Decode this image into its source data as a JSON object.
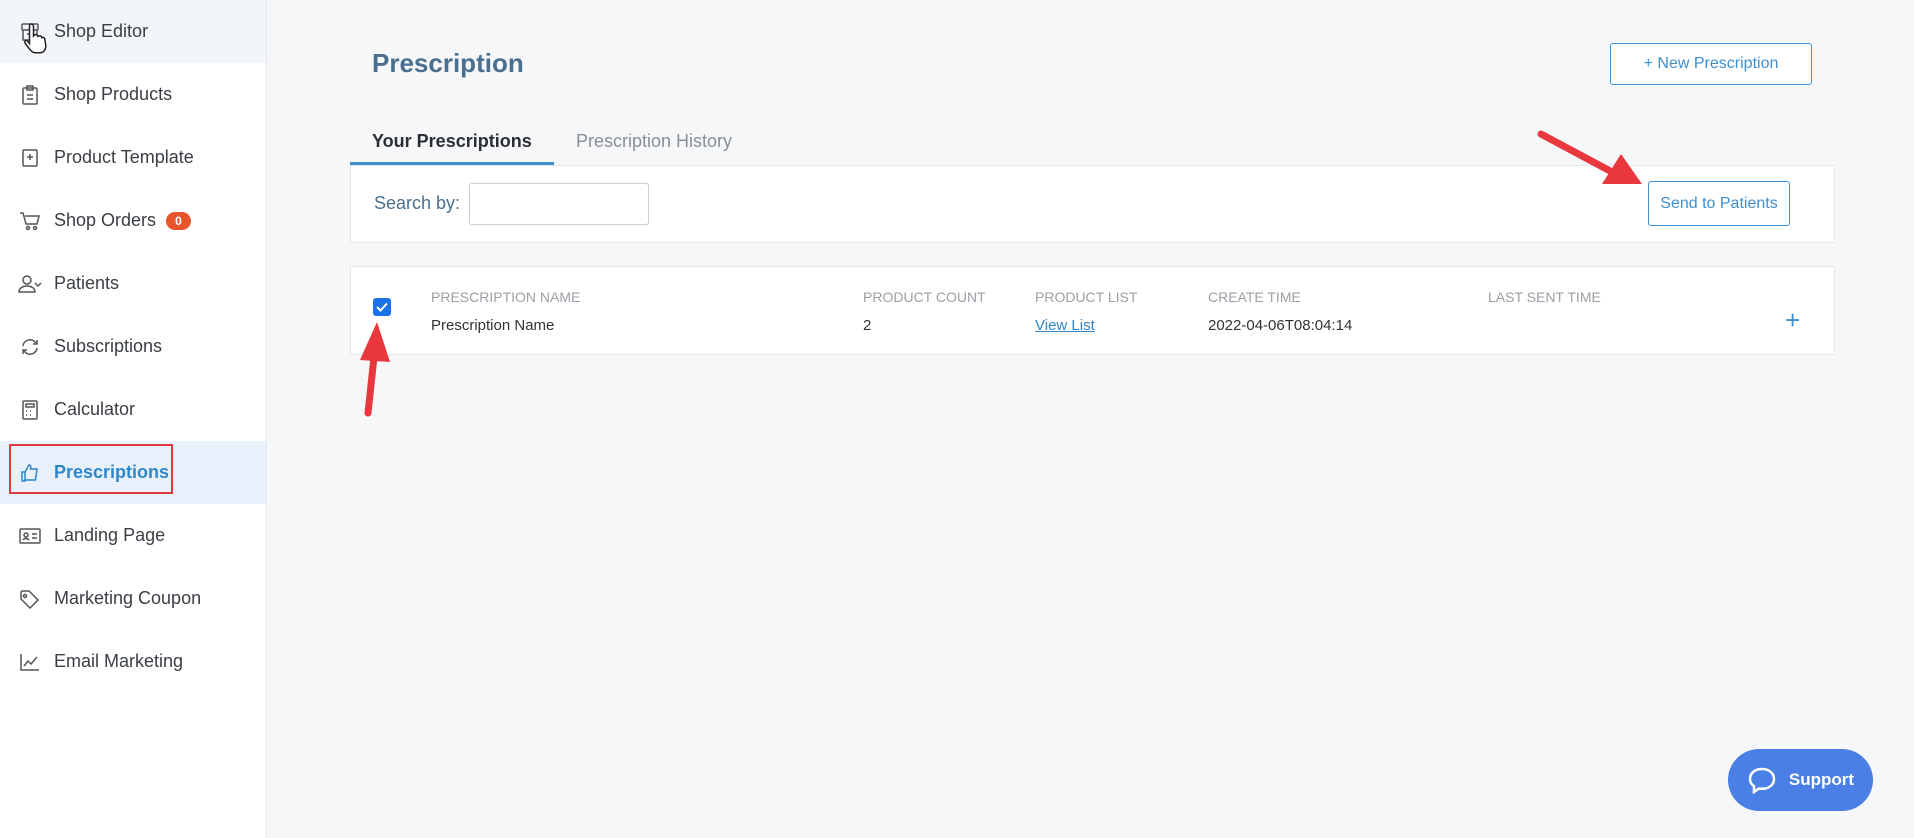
{
  "sidebar": {
    "items": [
      {
        "label": "Shop Editor",
        "icon": "store-icon"
      },
      {
        "label": "Shop Products",
        "icon": "clipboard-icon"
      },
      {
        "label": "Product Template",
        "icon": "template-icon"
      },
      {
        "label": "Shop Orders",
        "icon": "cart-icon",
        "badge": "0"
      },
      {
        "label": "Patients",
        "icon": "users-icon"
      },
      {
        "label": "Subscriptions",
        "icon": "refresh-icon"
      },
      {
        "label": "Calculator",
        "icon": "calculator-icon"
      },
      {
        "label": "Prescriptions",
        "icon": "thumbs-up-icon",
        "active": true
      },
      {
        "label": "Landing Page",
        "icon": "id-card-icon"
      },
      {
        "label": "Marketing Coupon",
        "icon": "tag-icon"
      },
      {
        "label": "Email Marketing",
        "icon": "chart-line-icon"
      }
    ]
  },
  "main": {
    "title": "Prescription",
    "new_button": "+ New Prescription",
    "tabs": [
      {
        "label": "Your Prescriptions",
        "active": true
      },
      {
        "label": "Prescription History",
        "active": false
      }
    ],
    "search": {
      "label": "Search by:",
      "value": "",
      "placeholder": ""
    },
    "send_button": "Send to Patients",
    "table": {
      "columns": [
        "PRESCRIPTION NAME",
        "PRODUCT COUNT",
        "PRODUCT LIST",
        "CREATE TIME",
        "LAST SENT TIME"
      ],
      "rows": [
        {
          "checked": true,
          "name": "Prescription Name",
          "count": "2",
          "list": "View List",
          "created": "2022-04-06T08:04:14",
          "last_sent": ""
        }
      ]
    }
  },
  "support": {
    "label": "Support"
  },
  "colors": {
    "accent": "#3d8fd0",
    "badge": "#e8552d",
    "annotation": "#e0393e",
    "support": "#4a7fe5"
  }
}
